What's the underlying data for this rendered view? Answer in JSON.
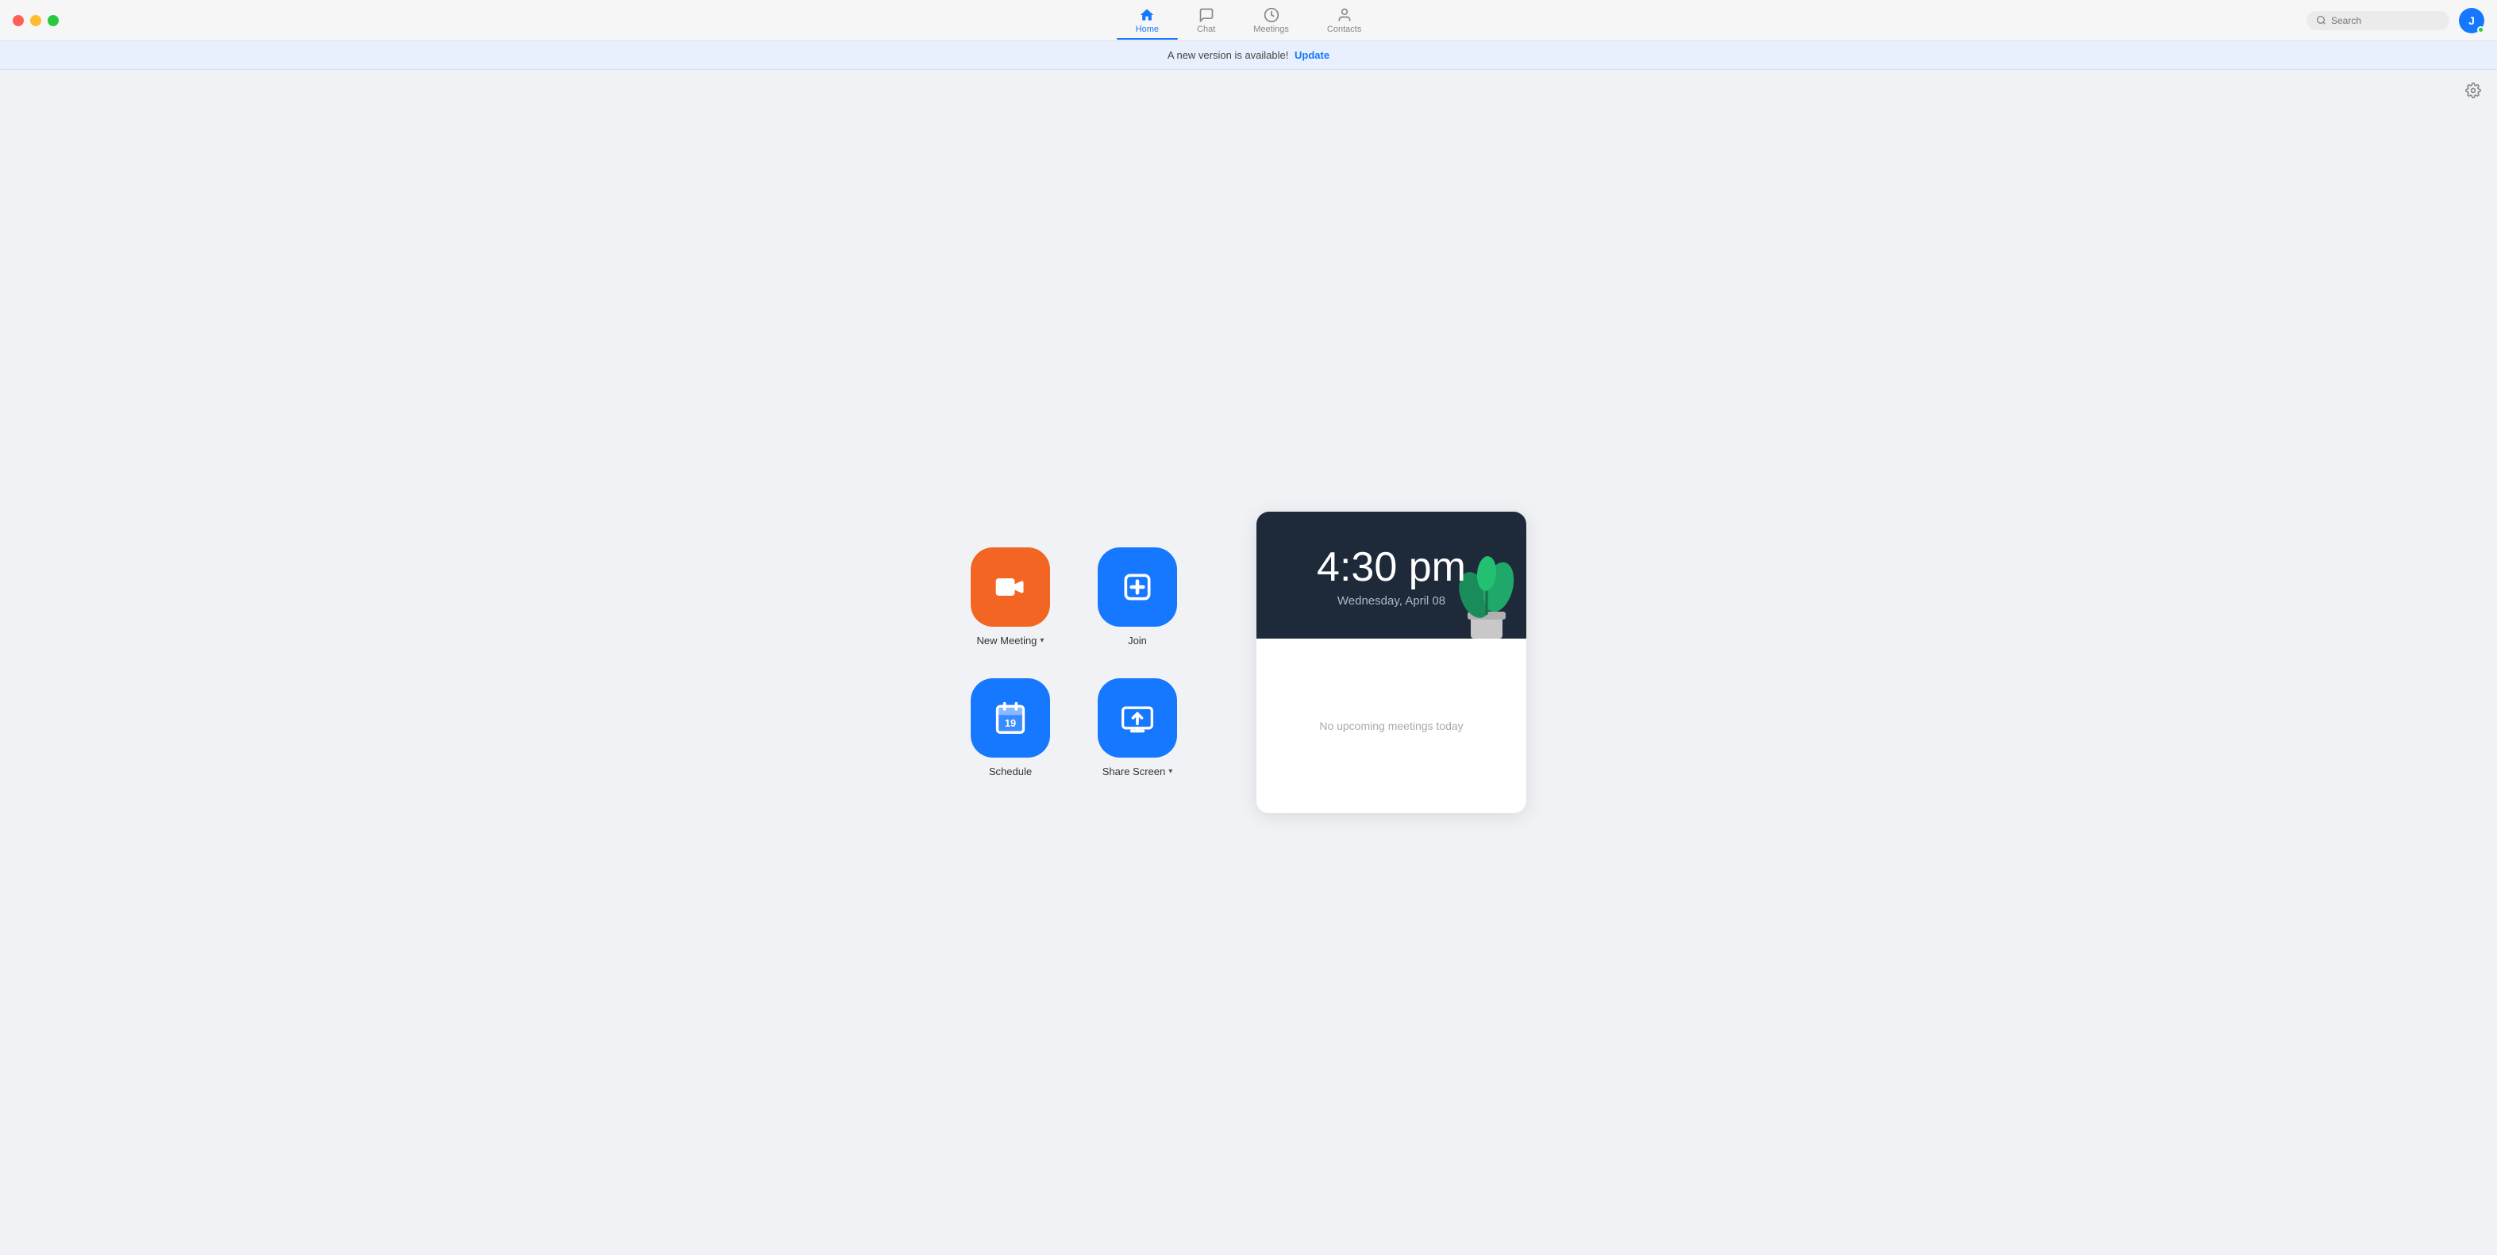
{
  "window": {
    "controls": {
      "close": "close",
      "minimize": "minimize",
      "maximize": "maximize"
    }
  },
  "nav": {
    "tabs": [
      {
        "id": "home",
        "label": "Home",
        "active": true
      },
      {
        "id": "chat",
        "label": "Chat",
        "active": false
      },
      {
        "id": "meetings",
        "label": "Meetings",
        "active": false
      },
      {
        "id": "contacts",
        "label": "Contacts",
        "active": false
      }
    ]
  },
  "search": {
    "placeholder": "Search"
  },
  "avatar": {
    "initial": "J",
    "status": "online"
  },
  "banner": {
    "message": "A new version is available!",
    "cta": "Update"
  },
  "actions": [
    {
      "id": "new-meeting",
      "label": "New Meeting",
      "icon": "camera",
      "color": "orange",
      "hasChevron": true
    },
    {
      "id": "join",
      "label": "Join",
      "icon": "plus",
      "color": "blue",
      "hasChevron": false
    },
    {
      "id": "schedule",
      "label": "Schedule",
      "icon": "calendar",
      "color": "blue",
      "hasChevron": false
    },
    {
      "id": "share-screen",
      "label": "Share Screen",
      "icon": "share",
      "color": "blue",
      "hasChevron": true
    }
  ],
  "clock": {
    "time": "4:30 pm",
    "date": "Wednesday, April 08",
    "no_meetings": "No upcoming meetings today"
  },
  "colors": {
    "accent": "#1677ff",
    "orange": "#f26522",
    "dark_bg": "#1e2a3a"
  }
}
